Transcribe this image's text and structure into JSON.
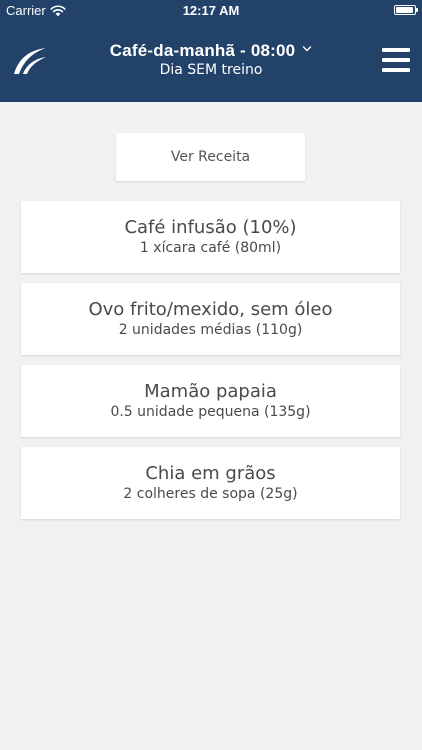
{
  "status_bar": {
    "carrier": "Carrier",
    "time": "12:17 AM",
    "wifi_icon": "wifi-icon",
    "battery_icon": "battery-icon"
  },
  "header": {
    "logo_icon": "app-logo-icon",
    "title": "Café-da-manhã - 08:00",
    "subtitle": "Dia SEM treino",
    "dropdown_icon": "chevron-down-icon",
    "menu_icon": "hamburger-menu-icon",
    "background_color": "#22426a"
  },
  "main": {
    "recipe_button_label": "Ver Receita",
    "foods": [
      {
        "name": "Café infusão (10%)",
        "portion": "1 xícara café (80ml)"
      },
      {
        "name": "Ovo frito/mexido, sem óleo",
        "portion": "2 unidades médias (110g)"
      },
      {
        "name": "Mamão papaia",
        "portion": "0.5 unidade pequena (135g)"
      },
      {
        "name": "Chia em grãos",
        "portion": "2 colheres de sopa (25g)"
      }
    ]
  }
}
